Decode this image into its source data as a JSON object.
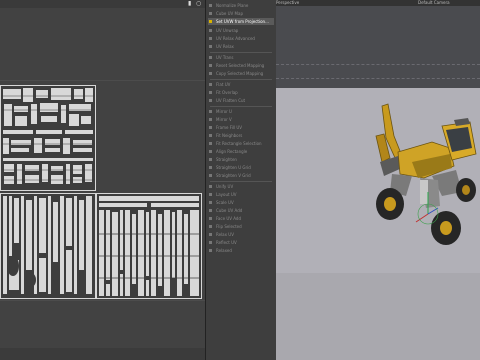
{
  "uv_editor": {
    "toolbar_icons": [
      "pin-icon",
      "settings-icon"
    ]
  },
  "context_menu": {
    "items": [
      {
        "label": "Normalize Plane",
        "selected": false
      },
      {
        "label": "Cube UV Map",
        "selected": false
      },
      {
        "label": "Set UVW from Projection...",
        "selected": true
      },
      {
        "label": "UV Unwrap",
        "selected": false
      },
      {
        "label": "UV Relax Advanced",
        "selected": false
      },
      {
        "label": "UV Relax",
        "selected": false
      },
      {
        "label": "UV Trans",
        "selected": false
      },
      {
        "label": "Reset Selected Mapping",
        "selected": false
      },
      {
        "label": "Copy Selected Mapping",
        "selected": false
      },
      {
        "label": "Flat UV",
        "selected": false
      },
      {
        "label": "Fit Overlap",
        "selected": false
      },
      {
        "label": "UV Flatten Cut",
        "selected": false
      },
      {
        "label": "Mirror U",
        "selected": false
      },
      {
        "label": "Mirror V",
        "selected": false
      },
      {
        "label": "Frame Fill UV",
        "selected": false
      },
      {
        "label": "Fit Neighbors",
        "selected": false
      },
      {
        "label": "Fit Rectangle Selection",
        "selected": false
      },
      {
        "label": "Align Rectangle",
        "selected": false
      },
      {
        "label": "Straighten",
        "selected": false
      },
      {
        "label": "Straighten U Grid",
        "selected": false
      },
      {
        "label": "Straighten V Grid",
        "selected": false
      },
      {
        "label": "Unify UV",
        "selected": false
      },
      {
        "label": "Layout UV",
        "selected": false
      },
      {
        "label": "Scale UV",
        "selected": false
      },
      {
        "label": "Cube UV Add",
        "selected": false
      },
      {
        "label": "Face UV Add",
        "selected": false
      },
      {
        "label": "Flip Selected",
        "selected": false
      },
      {
        "label": "Relax UV",
        "selected": false
      },
      {
        "label": "Reflect UV",
        "selected": false
      },
      {
        "label": "Relaxed",
        "selected": false
      }
    ]
  },
  "viewport": {
    "left_label": "Perspective",
    "camera_label": "Default Camera"
  }
}
